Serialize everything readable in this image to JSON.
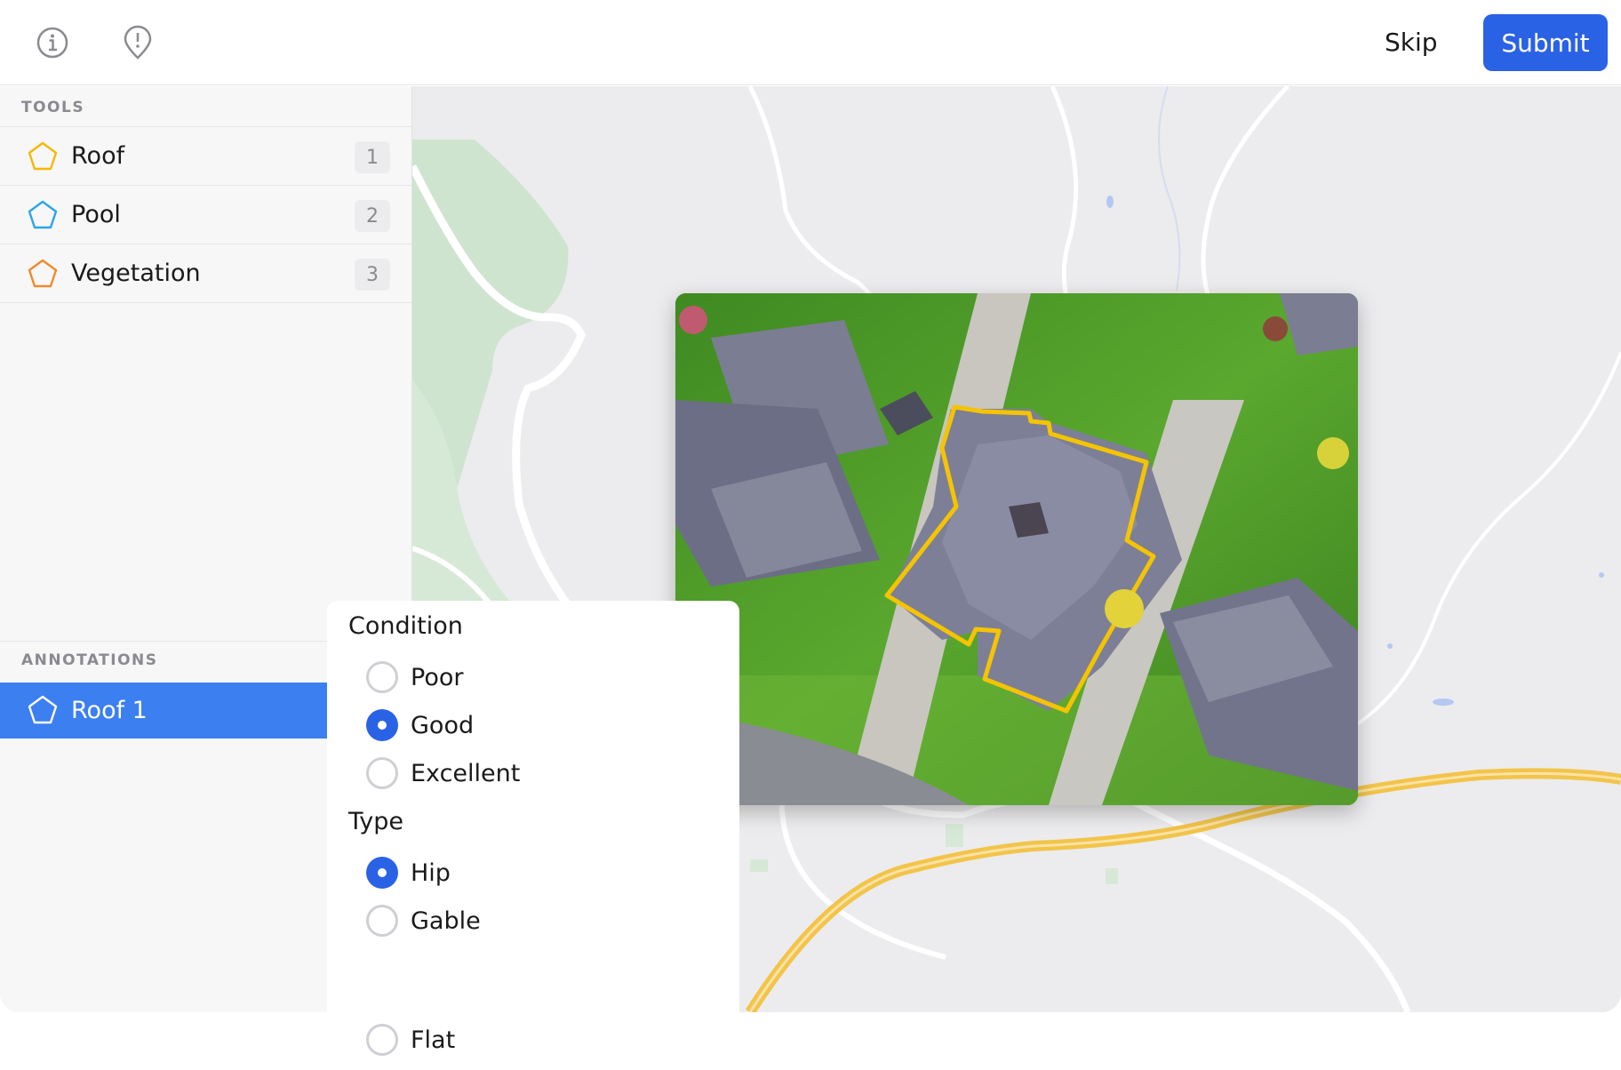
{
  "header": {
    "info_icon": "info-icon",
    "alert_icon": "alert-pin-icon",
    "skip_label": "Skip",
    "submit_label": "Submit"
  },
  "sidebar": {
    "tools_title": "TOOLS",
    "tools": [
      {
        "label": "Roof",
        "key": "1",
        "icon": "pentagon-icon",
        "color": "#f5b800"
      },
      {
        "label": "Pool",
        "key": "2",
        "icon": "pentagon-icon",
        "color": "#2aa6e6"
      },
      {
        "label": "Vegetation",
        "key": "3",
        "icon": "pentagon-icon",
        "color": "#f08a2a"
      }
    ],
    "annotations_title": "ANNOTATIONS",
    "annotations": [
      {
        "label": "Roof 1",
        "icon": "pentagon-icon",
        "selected": true
      }
    ]
  },
  "attributes": {
    "condition": {
      "title": "Condition",
      "options": [
        "Poor",
        "Good",
        "Excellent"
      ],
      "selected": "Good"
    },
    "type": {
      "title": "Type",
      "options": [
        "Hip",
        "Gable",
        "Flat"
      ],
      "selected": "Hip"
    }
  },
  "colors": {
    "accent": "#2a62e6",
    "selection": "#3c7ff0",
    "roof_outline": "#f5c400"
  }
}
